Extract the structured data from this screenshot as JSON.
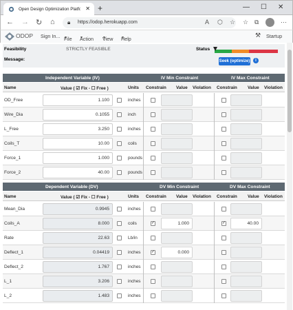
{
  "browser": {
    "tab_title": "Open Design Optimization Platfo",
    "url": "https://odop.herokuapp.com"
  },
  "nav": {
    "logo": "ODOP",
    "items": [
      "Sign In...",
      "File",
      "Action",
      "View",
      "Help"
    ],
    "startup": "Startup"
  },
  "summary": {
    "feasibility_label": "Feasibility",
    "feasibility_value": "STRICTLY FEASIBLE",
    "status_label": "Status",
    "message_label": "Message:",
    "seek_button": "Seek (optimize)",
    "status_colors": [
      "#28a745",
      "#f08b27",
      "#dc3545"
    ]
  },
  "iv_header": {
    "section": "Independent Variable (IV)",
    "min": "IV Min Constraint",
    "max": "IV Max Constraint",
    "col_name": "Name",
    "col_value": "Value ( ☑ Fix - ☐ Free )",
    "col_units": "Units",
    "col_constrain": "Constrain",
    "col_cvalue": "Value",
    "col_violation": "Violation"
  },
  "iv_rows": [
    {
      "name": "OD_Free",
      "value": "1.100",
      "unit": "inches"
    },
    {
      "name": "Wire_Dia",
      "value": "0.1055",
      "unit": "inch"
    },
    {
      "name": "L_Free",
      "value": "3.250",
      "unit": "inches"
    },
    {
      "name": "Coils_T",
      "value": "10.00",
      "unit": "coils"
    },
    {
      "name": "Force_1",
      "value": "1.000",
      "unit": "pounds"
    },
    {
      "name": "Force_2",
      "value": "40.00",
      "unit": "pounds"
    }
  ],
  "dv_header": {
    "section": "Dependent Variable (DV)",
    "min": "DV Min Constraint",
    "max": "DV Max Constraint",
    "col_name": "Name",
    "col_value": "Value ( ☑ Fix - ☐ Free )",
    "col_units": "Units",
    "col_constrain": "Constrain",
    "col_cvalue": "Value",
    "col_violation": "Violation"
  },
  "dv_rows": [
    {
      "name": "Mean_Dia",
      "value": "0.9945",
      "unit": "inches",
      "min_on": false,
      "min_val": "",
      "max_on": false,
      "max_val": ""
    },
    {
      "name": "Coils_A",
      "value": "8.000",
      "unit": "coils",
      "min_on": true,
      "min_val": "1.000",
      "max_on": true,
      "max_val": "40.00"
    },
    {
      "name": "Rate",
      "value": "22.63",
      "unit": "Lb/in",
      "min_on": false,
      "min_val": "",
      "max_on": false,
      "max_val": ""
    },
    {
      "name": "Deflect_1",
      "value": "0.04419",
      "unit": "inches",
      "min_on": true,
      "min_val": "0.000",
      "max_on": false,
      "max_val": ""
    },
    {
      "name": "Deflect_2",
      "value": "1.767",
      "unit": "inches",
      "min_on": false,
      "min_val": "",
      "max_on": false,
      "max_val": ""
    },
    {
      "name": "L_1",
      "value": "3.206",
      "unit": "inches",
      "min_on": false,
      "min_val": "",
      "max_on": false,
      "max_val": ""
    },
    {
      "name": "L_2",
      "value": "1.483",
      "unit": "inches",
      "min_on": false,
      "min_val": "",
      "max_on": false,
      "max_val": ""
    }
  ]
}
